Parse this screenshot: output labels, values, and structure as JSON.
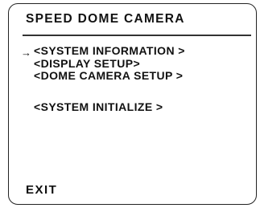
{
  "header": {
    "title": "SPEED DOME CAMERA"
  },
  "menu": {
    "selection_marker": "→",
    "items": [
      {
        "label": "<SYSTEM INFORMATION >"
      },
      {
        "label": "<DISPLAY SETUP>"
      },
      {
        "label": "<DOME CAMERA SETUP >"
      },
      {
        "label": "<SYSTEM INITIALIZE >"
      }
    ],
    "exit_label": "EXIT"
  }
}
